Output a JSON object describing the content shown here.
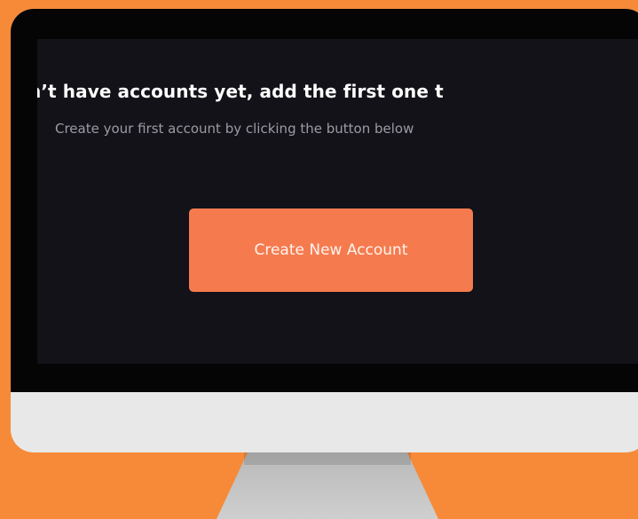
{
  "screen": {
    "headline": "n’t have accounts yet, add the first one t",
    "subline": "Create your first account by clicking the button below",
    "cta_label": "Create New Account"
  },
  "colors": {
    "background": "#f78a38",
    "screen": "#121218",
    "bezel": "#050505",
    "monitor_chin": "#e8e8e8",
    "stand": "#c4c4c4",
    "cta": "#f57b4f"
  }
}
